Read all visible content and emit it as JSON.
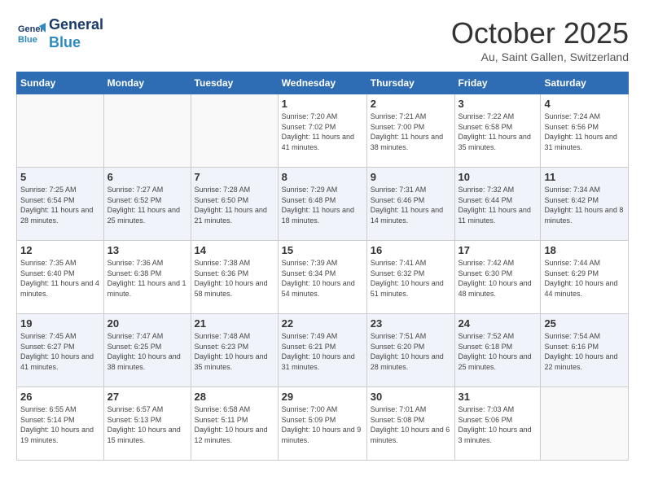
{
  "header": {
    "logo_line1": "General",
    "logo_line2": "Blue",
    "month": "October 2025",
    "location": "Au, Saint Gallen, Switzerland"
  },
  "weekdays": [
    "Sunday",
    "Monday",
    "Tuesday",
    "Wednesday",
    "Thursday",
    "Friday",
    "Saturday"
  ],
  "weeks": [
    [
      {
        "day": "",
        "info": ""
      },
      {
        "day": "",
        "info": ""
      },
      {
        "day": "",
        "info": ""
      },
      {
        "day": "1",
        "info": "Sunrise: 7:20 AM\nSunset: 7:02 PM\nDaylight: 11 hours and 41 minutes."
      },
      {
        "day": "2",
        "info": "Sunrise: 7:21 AM\nSunset: 7:00 PM\nDaylight: 11 hours and 38 minutes."
      },
      {
        "day": "3",
        "info": "Sunrise: 7:22 AM\nSunset: 6:58 PM\nDaylight: 11 hours and 35 minutes."
      },
      {
        "day": "4",
        "info": "Sunrise: 7:24 AM\nSunset: 6:56 PM\nDaylight: 11 hours and 31 minutes."
      }
    ],
    [
      {
        "day": "5",
        "info": "Sunrise: 7:25 AM\nSunset: 6:54 PM\nDaylight: 11 hours and 28 minutes."
      },
      {
        "day": "6",
        "info": "Sunrise: 7:27 AM\nSunset: 6:52 PM\nDaylight: 11 hours and 25 minutes."
      },
      {
        "day": "7",
        "info": "Sunrise: 7:28 AM\nSunset: 6:50 PM\nDaylight: 11 hours and 21 minutes."
      },
      {
        "day": "8",
        "info": "Sunrise: 7:29 AM\nSunset: 6:48 PM\nDaylight: 11 hours and 18 minutes."
      },
      {
        "day": "9",
        "info": "Sunrise: 7:31 AM\nSunset: 6:46 PM\nDaylight: 11 hours and 14 minutes."
      },
      {
        "day": "10",
        "info": "Sunrise: 7:32 AM\nSunset: 6:44 PM\nDaylight: 11 hours and 11 minutes."
      },
      {
        "day": "11",
        "info": "Sunrise: 7:34 AM\nSunset: 6:42 PM\nDaylight: 11 hours and 8 minutes."
      }
    ],
    [
      {
        "day": "12",
        "info": "Sunrise: 7:35 AM\nSunset: 6:40 PM\nDaylight: 11 hours and 4 minutes."
      },
      {
        "day": "13",
        "info": "Sunrise: 7:36 AM\nSunset: 6:38 PM\nDaylight: 11 hours and 1 minute."
      },
      {
        "day": "14",
        "info": "Sunrise: 7:38 AM\nSunset: 6:36 PM\nDaylight: 10 hours and 58 minutes."
      },
      {
        "day": "15",
        "info": "Sunrise: 7:39 AM\nSunset: 6:34 PM\nDaylight: 10 hours and 54 minutes."
      },
      {
        "day": "16",
        "info": "Sunrise: 7:41 AM\nSunset: 6:32 PM\nDaylight: 10 hours and 51 minutes."
      },
      {
        "day": "17",
        "info": "Sunrise: 7:42 AM\nSunset: 6:30 PM\nDaylight: 10 hours and 48 minutes."
      },
      {
        "day": "18",
        "info": "Sunrise: 7:44 AM\nSunset: 6:29 PM\nDaylight: 10 hours and 44 minutes."
      }
    ],
    [
      {
        "day": "19",
        "info": "Sunrise: 7:45 AM\nSunset: 6:27 PM\nDaylight: 10 hours and 41 minutes."
      },
      {
        "day": "20",
        "info": "Sunrise: 7:47 AM\nSunset: 6:25 PM\nDaylight: 10 hours and 38 minutes."
      },
      {
        "day": "21",
        "info": "Sunrise: 7:48 AM\nSunset: 6:23 PM\nDaylight: 10 hours and 35 minutes."
      },
      {
        "day": "22",
        "info": "Sunrise: 7:49 AM\nSunset: 6:21 PM\nDaylight: 10 hours and 31 minutes."
      },
      {
        "day": "23",
        "info": "Sunrise: 7:51 AM\nSunset: 6:20 PM\nDaylight: 10 hours and 28 minutes."
      },
      {
        "day": "24",
        "info": "Sunrise: 7:52 AM\nSunset: 6:18 PM\nDaylight: 10 hours and 25 minutes."
      },
      {
        "day": "25",
        "info": "Sunrise: 7:54 AM\nSunset: 6:16 PM\nDaylight: 10 hours and 22 minutes."
      }
    ],
    [
      {
        "day": "26",
        "info": "Sunrise: 6:55 AM\nSunset: 5:14 PM\nDaylight: 10 hours and 19 minutes."
      },
      {
        "day": "27",
        "info": "Sunrise: 6:57 AM\nSunset: 5:13 PM\nDaylight: 10 hours and 15 minutes."
      },
      {
        "day": "28",
        "info": "Sunrise: 6:58 AM\nSunset: 5:11 PM\nDaylight: 10 hours and 12 minutes."
      },
      {
        "day": "29",
        "info": "Sunrise: 7:00 AM\nSunset: 5:09 PM\nDaylight: 10 hours and 9 minutes."
      },
      {
        "day": "30",
        "info": "Sunrise: 7:01 AM\nSunset: 5:08 PM\nDaylight: 10 hours and 6 minutes."
      },
      {
        "day": "31",
        "info": "Sunrise: 7:03 AM\nSunset: 5:06 PM\nDaylight: 10 hours and 3 minutes."
      },
      {
        "day": "",
        "info": ""
      }
    ]
  ]
}
